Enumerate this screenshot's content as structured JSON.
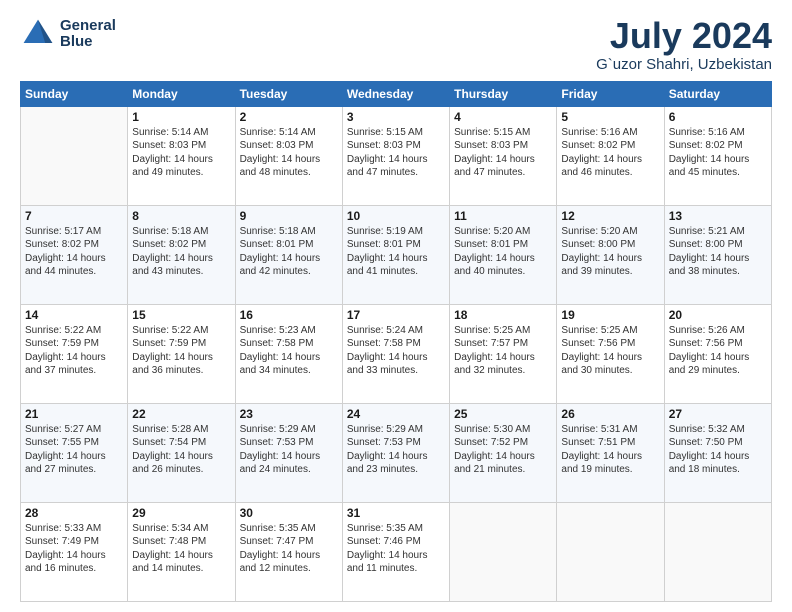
{
  "header": {
    "logo_line1": "General",
    "logo_line2": "Blue",
    "main_title": "July 2024",
    "subtitle": "G`uzor Shahri, Uzbekistan"
  },
  "days_of_week": [
    "Sunday",
    "Monday",
    "Tuesday",
    "Wednesday",
    "Thursday",
    "Friday",
    "Saturday"
  ],
  "weeks": [
    [
      {
        "day": "",
        "info": ""
      },
      {
        "day": "1",
        "info": "Sunrise: 5:14 AM\nSunset: 8:03 PM\nDaylight: 14 hours\nand 49 minutes."
      },
      {
        "day": "2",
        "info": "Sunrise: 5:14 AM\nSunset: 8:03 PM\nDaylight: 14 hours\nand 48 minutes."
      },
      {
        "day": "3",
        "info": "Sunrise: 5:15 AM\nSunset: 8:03 PM\nDaylight: 14 hours\nand 47 minutes."
      },
      {
        "day": "4",
        "info": "Sunrise: 5:15 AM\nSunset: 8:03 PM\nDaylight: 14 hours\nand 47 minutes."
      },
      {
        "day": "5",
        "info": "Sunrise: 5:16 AM\nSunset: 8:02 PM\nDaylight: 14 hours\nand 46 minutes."
      },
      {
        "day": "6",
        "info": "Sunrise: 5:16 AM\nSunset: 8:02 PM\nDaylight: 14 hours\nand 45 minutes."
      }
    ],
    [
      {
        "day": "7",
        "info": "Sunrise: 5:17 AM\nSunset: 8:02 PM\nDaylight: 14 hours\nand 44 minutes."
      },
      {
        "day": "8",
        "info": "Sunrise: 5:18 AM\nSunset: 8:02 PM\nDaylight: 14 hours\nand 43 minutes."
      },
      {
        "day": "9",
        "info": "Sunrise: 5:18 AM\nSunset: 8:01 PM\nDaylight: 14 hours\nand 42 minutes."
      },
      {
        "day": "10",
        "info": "Sunrise: 5:19 AM\nSunset: 8:01 PM\nDaylight: 14 hours\nand 41 minutes."
      },
      {
        "day": "11",
        "info": "Sunrise: 5:20 AM\nSunset: 8:01 PM\nDaylight: 14 hours\nand 40 minutes."
      },
      {
        "day": "12",
        "info": "Sunrise: 5:20 AM\nSunset: 8:00 PM\nDaylight: 14 hours\nand 39 minutes."
      },
      {
        "day": "13",
        "info": "Sunrise: 5:21 AM\nSunset: 8:00 PM\nDaylight: 14 hours\nand 38 minutes."
      }
    ],
    [
      {
        "day": "14",
        "info": "Sunrise: 5:22 AM\nSunset: 7:59 PM\nDaylight: 14 hours\nand 37 minutes."
      },
      {
        "day": "15",
        "info": "Sunrise: 5:22 AM\nSunset: 7:59 PM\nDaylight: 14 hours\nand 36 minutes."
      },
      {
        "day": "16",
        "info": "Sunrise: 5:23 AM\nSunset: 7:58 PM\nDaylight: 14 hours\nand 34 minutes."
      },
      {
        "day": "17",
        "info": "Sunrise: 5:24 AM\nSunset: 7:58 PM\nDaylight: 14 hours\nand 33 minutes."
      },
      {
        "day": "18",
        "info": "Sunrise: 5:25 AM\nSunset: 7:57 PM\nDaylight: 14 hours\nand 32 minutes."
      },
      {
        "day": "19",
        "info": "Sunrise: 5:25 AM\nSunset: 7:56 PM\nDaylight: 14 hours\nand 30 minutes."
      },
      {
        "day": "20",
        "info": "Sunrise: 5:26 AM\nSunset: 7:56 PM\nDaylight: 14 hours\nand 29 minutes."
      }
    ],
    [
      {
        "day": "21",
        "info": "Sunrise: 5:27 AM\nSunset: 7:55 PM\nDaylight: 14 hours\nand 27 minutes."
      },
      {
        "day": "22",
        "info": "Sunrise: 5:28 AM\nSunset: 7:54 PM\nDaylight: 14 hours\nand 26 minutes."
      },
      {
        "day": "23",
        "info": "Sunrise: 5:29 AM\nSunset: 7:53 PM\nDaylight: 14 hours\nand 24 minutes."
      },
      {
        "day": "24",
        "info": "Sunrise: 5:29 AM\nSunset: 7:53 PM\nDaylight: 14 hours\nand 23 minutes."
      },
      {
        "day": "25",
        "info": "Sunrise: 5:30 AM\nSunset: 7:52 PM\nDaylight: 14 hours\nand 21 minutes."
      },
      {
        "day": "26",
        "info": "Sunrise: 5:31 AM\nSunset: 7:51 PM\nDaylight: 14 hours\nand 19 minutes."
      },
      {
        "day": "27",
        "info": "Sunrise: 5:32 AM\nSunset: 7:50 PM\nDaylight: 14 hours\nand 18 minutes."
      }
    ],
    [
      {
        "day": "28",
        "info": "Sunrise: 5:33 AM\nSunset: 7:49 PM\nDaylight: 14 hours\nand 16 minutes."
      },
      {
        "day": "29",
        "info": "Sunrise: 5:34 AM\nSunset: 7:48 PM\nDaylight: 14 hours\nand 14 minutes."
      },
      {
        "day": "30",
        "info": "Sunrise: 5:35 AM\nSunset: 7:47 PM\nDaylight: 14 hours\nand 12 minutes."
      },
      {
        "day": "31",
        "info": "Sunrise: 5:35 AM\nSunset: 7:46 PM\nDaylight: 14 hours\nand 11 minutes."
      },
      {
        "day": "",
        "info": ""
      },
      {
        "day": "",
        "info": ""
      },
      {
        "day": "",
        "info": ""
      }
    ]
  ]
}
